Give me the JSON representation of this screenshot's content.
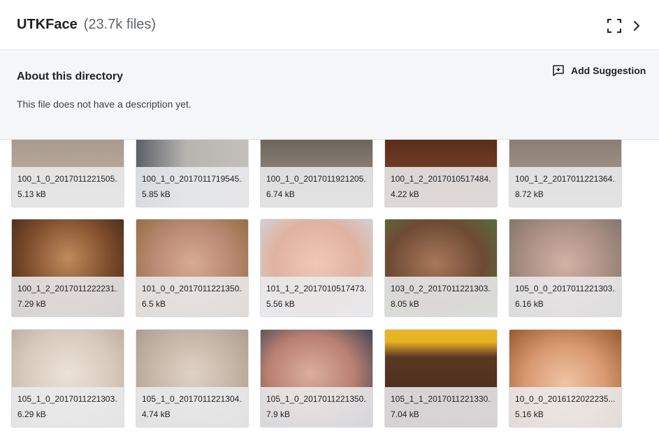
{
  "header": {
    "title": "UTKFace",
    "count": "(23.7k files)"
  },
  "about": {
    "title": "About this directory",
    "description": "This file does not have a description yet.",
    "suggest_label": "Add Suggestion"
  },
  "icons": {
    "fullscreen": "fullscreen-icon",
    "next": "chevron-right-icon",
    "suggest": "add-suggestion-icon"
  },
  "files": [
    {
      "name": "100_1_0_2017011221505...",
      "size": "5.13 kB",
      "bg": "#b8a898"
    },
    {
      "name": "100_1_0_2017011719545...",
      "size": "5.85 kB",
      "bg": "#a9aaa6"
    },
    {
      "name": "100_1_0_2017011921205...",
      "size": "6.74 kB",
      "bg": "#8f867b"
    },
    {
      "name": "100_1_2_2017010517484...",
      "size": "4.22 kB",
      "bg": "#6b3b24"
    },
    {
      "name": "100_1_2_2017011221364...",
      "size": "8.72 kB",
      "bg": "#9b8f84"
    },
    {
      "name": "100_1_2_2017011222231...",
      "size": "7.29 kB",
      "bg": "#8a5a3a"
    },
    {
      "name": "101_0_0_2017011221350...",
      "size": "6.5 kB",
      "bg": "#c29881"
    },
    {
      "name": "101_1_2_2017010517473...",
      "size": "5.56 kB",
      "bg": "#e0b6a6"
    },
    {
      "name": "103_0_2_2017011221303...",
      "size": "8.05 kB",
      "bg": "#7c5a44"
    },
    {
      "name": "105_0_0_2017011221303...",
      "size": "6.16 kB",
      "bg": "#b3a096"
    },
    {
      "name": "105_1_0_2017011221303...",
      "size": "6.29 kB",
      "bg": "#d8cec4"
    },
    {
      "name": "105_1_0_2017011221304...",
      "size": "4.74 kB",
      "bg": "#c6b8ad"
    },
    {
      "name": "105_1_0_2017011221350...",
      "size": "7.9 kB",
      "bg": "#b48a78"
    },
    {
      "name": "105_1_1_2017011221330...",
      "size": "7.04 kB",
      "bg": "#5a3a26"
    },
    {
      "name": "10_0_0_2016122022235...",
      "size": "5.16 kB",
      "bg": "#d9a583"
    }
  ]
}
